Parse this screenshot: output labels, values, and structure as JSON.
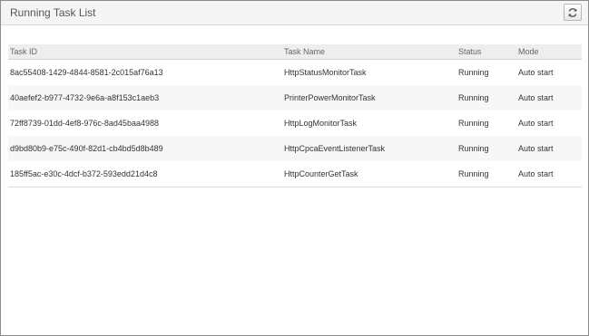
{
  "panel": {
    "title": "Running Task List",
    "refresh_icon": "refresh-icon"
  },
  "table": {
    "columns": {
      "task_id": "Task ID",
      "task_name": "Task Name",
      "status": "Status",
      "mode": "Mode"
    },
    "rows": [
      {
        "task_id": "8ac55408-1429-4844-8581-2c015af76a13",
        "task_name": "HttpStatusMonitorTask",
        "status": "Running",
        "mode": "Auto start"
      },
      {
        "task_id": "40aefef2-b977-4732-9e6a-a8f153c1aeb3",
        "task_name": "PrinterPowerMonitorTask",
        "status": "Running",
        "mode": "Auto start"
      },
      {
        "task_id": "72ff8739-01dd-4ef8-976c-8ad45baa4988",
        "task_name": "HttpLogMonitorTask",
        "status": "Running",
        "mode": "Auto start"
      },
      {
        "task_id": "d9bd80b9-e75c-490f-82d1-cb4bd5d8b489",
        "task_name": "HttpCpcaEventListenerTask",
        "status": "Running",
        "mode": "Auto start"
      },
      {
        "task_id": "185ff5ac-e30c-4dcf-b372-593edd21d4c8",
        "task_name": "HttpCounterGetTask",
        "status": "Running",
        "mode": "Auto start"
      }
    ]
  }
}
